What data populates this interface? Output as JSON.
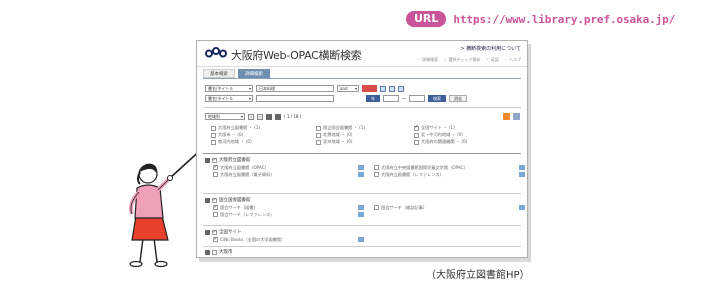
{
  "url_label": "URL",
  "url": "https://www.library.pref.osaka.jp/",
  "app_title": "大阪府Web-OPAC横断検索",
  "help_link": "> 横断検索の利用について",
  "top_links": [
    "・ 詳細検索",
    "・ 選択チェック保存",
    "・ 英語",
    "・ ヘルプ"
  ],
  "tabs": [
    "基本検索",
    "詳細検索"
  ],
  "search": {
    "field1": "書名/タイトル",
    "value1": "日本料理",
    "op": "and",
    "field2": "書名/タイトル",
    "search_button": "検索",
    "clear_button": "消去",
    "range_label": "年"
  },
  "library_bar": {
    "select": "地域別",
    "page_indicator": "( 1 / 18 )"
  },
  "library_groups": [
    {
      "label": "大阪府立図書館 ・ (1)",
      "checked": false
    },
    {
      "label": "国立国会図書館 ・ (1)",
      "checked": false
    },
    {
      "label": "全国サイト ・ (1)",
      "checked": true
    },
    {
      "label": "大阪市 ・ (0)",
      "checked": false
    },
    {
      "label": "北摂地域 ・ (0)",
      "checked": false
    },
    {
      "label": "北・中河内地域 ・ (0)",
      "checked": false
    },
    {
      "label": "南河内地域 ・ (0)",
      "checked": false
    },
    {
      "label": "泉州地域 ・ (0)",
      "checked": false
    },
    {
      "label": "大阪府の関連機関 ・ (0)",
      "checked": false
    }
  ],
  "blocks": [
    {
      "title": "大阪府立図書館",
      "rows": [
        [
          "大阪府立図書館（OPAC）",
          "大阪府立中央図書館国際児童文学館（OPAC）"
        ],
        [
          "大阪府立図書館（電子資料）",
          "大阪府立図書館（レファレンス）"
        ]
      ]
    },
    {
      "title": "国立国会図書館",
      "rows": [
        [
          "国会サーチ（図書）",
          "国会サーチ（雑誌記事）"
        ],
        [
          "国会サーチ（レファレンス）",
          ""
        ]
      ]
    },
    {
      "title": "全国サイト",
      "rows": [
        [
          "CiNii Books（全国の大学図書館）",
          ""
        ]
      ]
    },
    {
      "title": "大阪市",
      "rows": []
    }
  ],
  "credit": "（大阪府立図書館HP）",
  "colors": {
    "url_accent": "#c9549a",
    "logo_navy": "#1b2a5c",
    "tab_active": "#6f8fb0",
    "button_blue": "#3c5f99",
    "girl_shirt": "#f0a0b8",
    "girl_skirt": "#e8412c"
  }
}
